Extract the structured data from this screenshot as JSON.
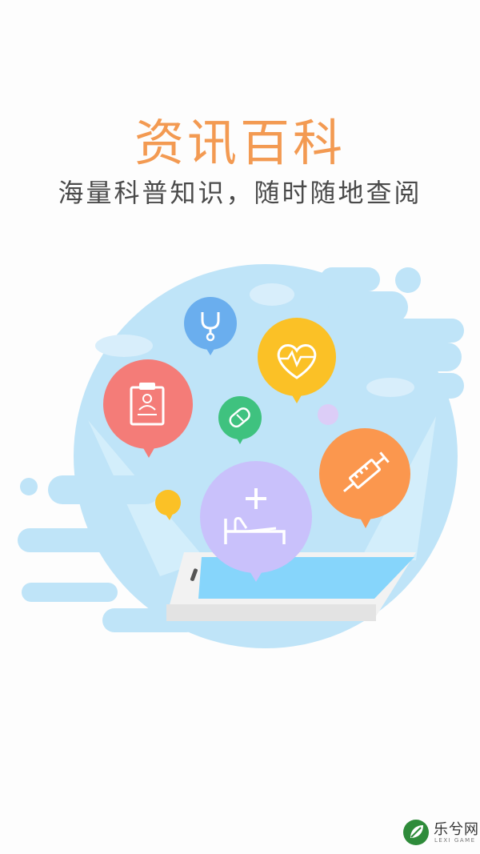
{
  "header": {
    "title": "资讯百科",
    "subtitle": "海量科普知识，随时随地查阅"
  },
  "illustration": {
    "bubbles": [
      {
        "name": "clipboard-icon-bubble",
        "color": "#f47c78"
      },
      {
        "name": "stethoscope-icon-bubble",
        "color": "#6aaeee"
      },
      {
        "name": "heart-icon-bubble",
        "color": "#fbc126"
      },
      {
        "name": "bandage-icon-bubble",
        "color": "#3fc27f"
      },
      {
        "name": "syringe-icon-bubble",
        "color": "#fb974e"
      },
      {
        "name": "hospital-bed-icon-bubble",
        "color": "#c9c1fb"
      }
    ]
  },
  "watermark": {
    "text": "乐兮网",
    "sub": "LEXI GAME"
  }
}
